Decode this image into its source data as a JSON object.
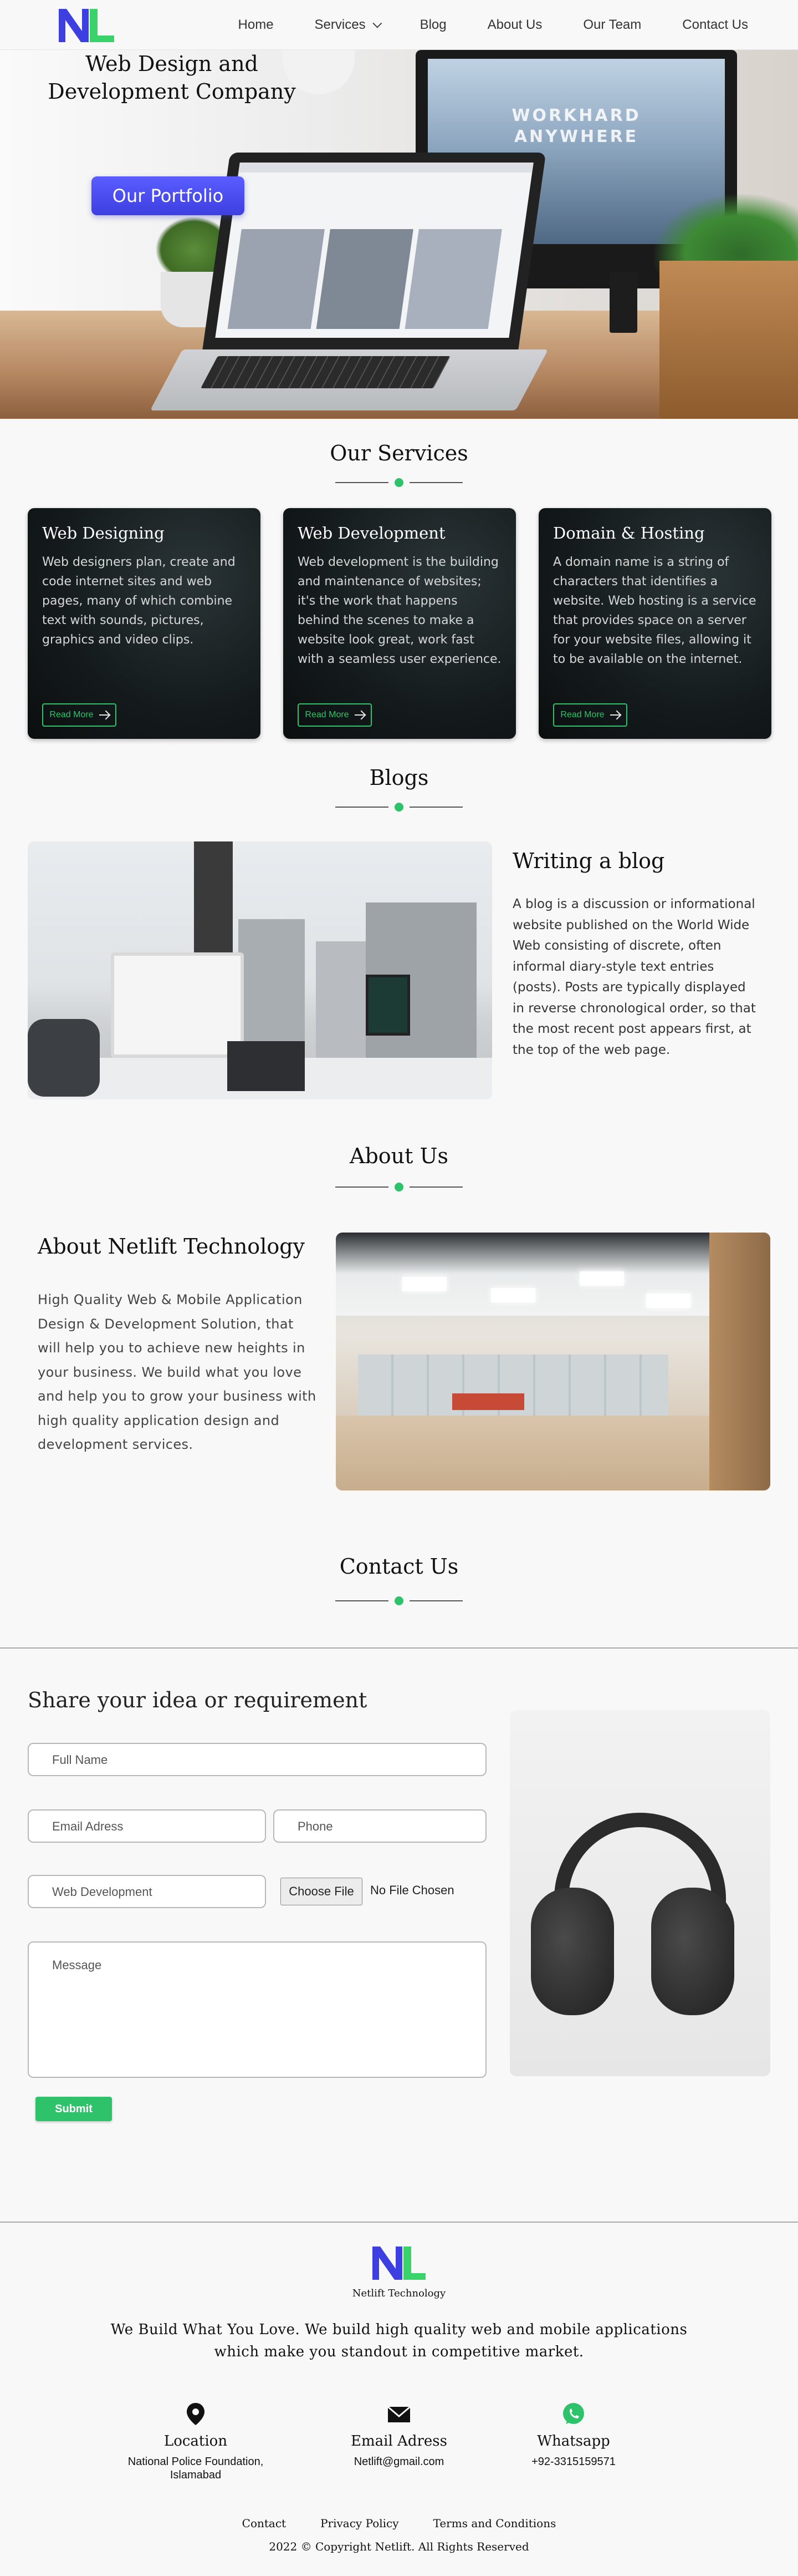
{
  "nav": {
    "items": [
      {
        "label": "Home"
      },
      {
        "label": "Services"
      },
      {
        "label": "Blog"
      },
      {
        "label": "About Us"
      },
      {
        "label": "Our Team"
      },
      {
        "label": "Contact Us"
      }
    ]
  },
  "hero": {
    "title": "Web Design and Development Company",
    "button": "Our Portfolio",
    "monitor_text_line1": "WORKHARD",
    "monitor_text_line2": "ANYWHERE"
  },
  "services": {
    "heading": "Our Services",
    "cards": [
      {
        "title": "Web Designing",
        "text": "Web designers plan, create and code internet sites and web pages, many of which combine text with sounds, pictures, graphics and video clips.",
        "button": "Read More"
      },
      {
        "title": "Web Development",
        "text": "Web development is the building and maintenance of websites; it's the work that happens behind the scenes to make a website look great, work fast with a seamless user experience.",
        "button": "Read More"
      },
      {
        "title": "Domain & Hosting",
        "text": "A domain name is a string of characters that identifies a website. Web hosting is a service that provides space on a server for your website files, allowing it to be available on the internet.",
        "button": "Read More"
      }
    ]
  },
  "blogs": {
    "heading": "Blogs",
    "title": "Writing a blog",
    "text": "A blog is a discussion or informational website published on the World Wide Web consisting of discrete, often informal diary-style text entries (posts). Posts are typically displayed in reverse chronological order, so that the most recent post appears first, at the top of the web page."
  },
  "about": {
    "heading": "About Us",
    "title": "About Netlift Technology",
    "text": "High Quality Web & Mobile Application Design & Development Solution, that will help you to achieve new heights in your business. We build what you love and help you to grow your business with high quality application design and development services."
  },
  "contact": {
    "heading": "Contact Us",
    "share_title": "Share your idea or requirement",
    "full_name": "Full Name",
    "email": "Email Adress",
    "phone": "Phone",
    "service": "Web Development",
    "file_button": "Choose File",
    "file_label": "No File Chosen",
    "message": "Message",
    "submit": "Submit"
  },
  "footer": {
    "name": "Netlift Technology",
    "tagline": "We Build What You Love. We build high quality web and mobile applications which make you standout in competitive market.",
    "location_title": "Location",
    "location_line1": "National Police Foundation,",
    "location_line2": "Islamabad",
    "email_title": "Email Adress",
    "email_value": "Netlift@gmail.com",
    "whatsapp_title": "Whatsapp",
    "whatsapp_value": "+92-3315159571",
    "links": [
      {
        "label": "Contact"
      },
      {
        "label": "Privacy Policy"
      },
      {
        "label": "Terms and Conditions"
      }
    ],
    "copyright": "2022 © Copyright Netlift. All Rights Reserved"
  },
  "colors": {
    "accent_green": "#2ec36b",
    "brand_blue": "#3d3fe0",
    "logo_green": "#3ad36a"
  },
  "icons": [
    "location-pin-icon",
    "envelope-icon",
    "whatsapp-icon",
    "arrow-right-icon",
    "chevron-down-icon"
  ]
}
